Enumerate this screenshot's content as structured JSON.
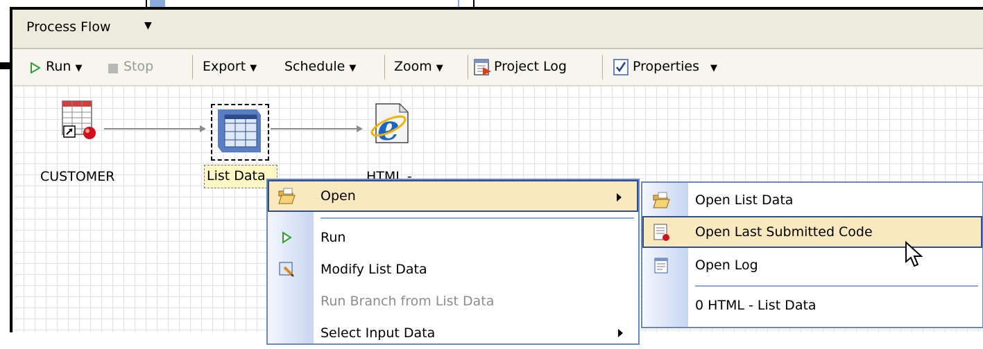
{
  "window": {
    "title": "Process Flow"
  },
  "toolbar": {
    "run": "Run",
    "stop": "Stop",
    "export": "Export",
    "schedule": "Schedule",
    "zoom": "Zoom",
    "project_log": "Project Log",
    "properties": "Properties"
  },
  "flow": {
    "nodes": [
      {
        "label": "CUSTOMER",
        "icon": "table-icon"
      },
      {
        "label": "List Data",
        "icon": "task-icon"
      },
      {
        "label": "HTML -",
        "icon": "internet-explorer-icon"
      }
    ]
  },
  "context_menu": {
    "items": [
      {
        "label": "Open",
        "icon": "folder-open-icon",
        "submenu": true,
        "highlighted": true
      },
      {
        "label": "Run",
        "icon": "run-icon"
      },
      {
        "label": "Modify List Data",
        "icon": "edit-icon"
      },
      {
        "label": "Run Branch from List Data",
        "disabled": true
      },
      {
        "label": "Select Input Data",
        "submenu": true
      }
    ]
  },
  "submenu": {
    "items": [
      {
        "label": "Open List Data",
        "icon": "folder-open-icon"
      },
      {
        "label": "Open Last Submitted Code",
        "icon": "code-icon",
        "highlighted": true
      },
      {
        "label": "Open Log",
        "icon": "log-icon"
      },
      {
        "label": "0 HTML - List Data"
      }
    ]
  },
  "colors": {
    "menu_border": "#6b86bd",
    "highlight_bg": "#fae9bf",
    "highlight_border": "#2f4d8f",
    "run_green": "#2e9f2e"
  }
}
